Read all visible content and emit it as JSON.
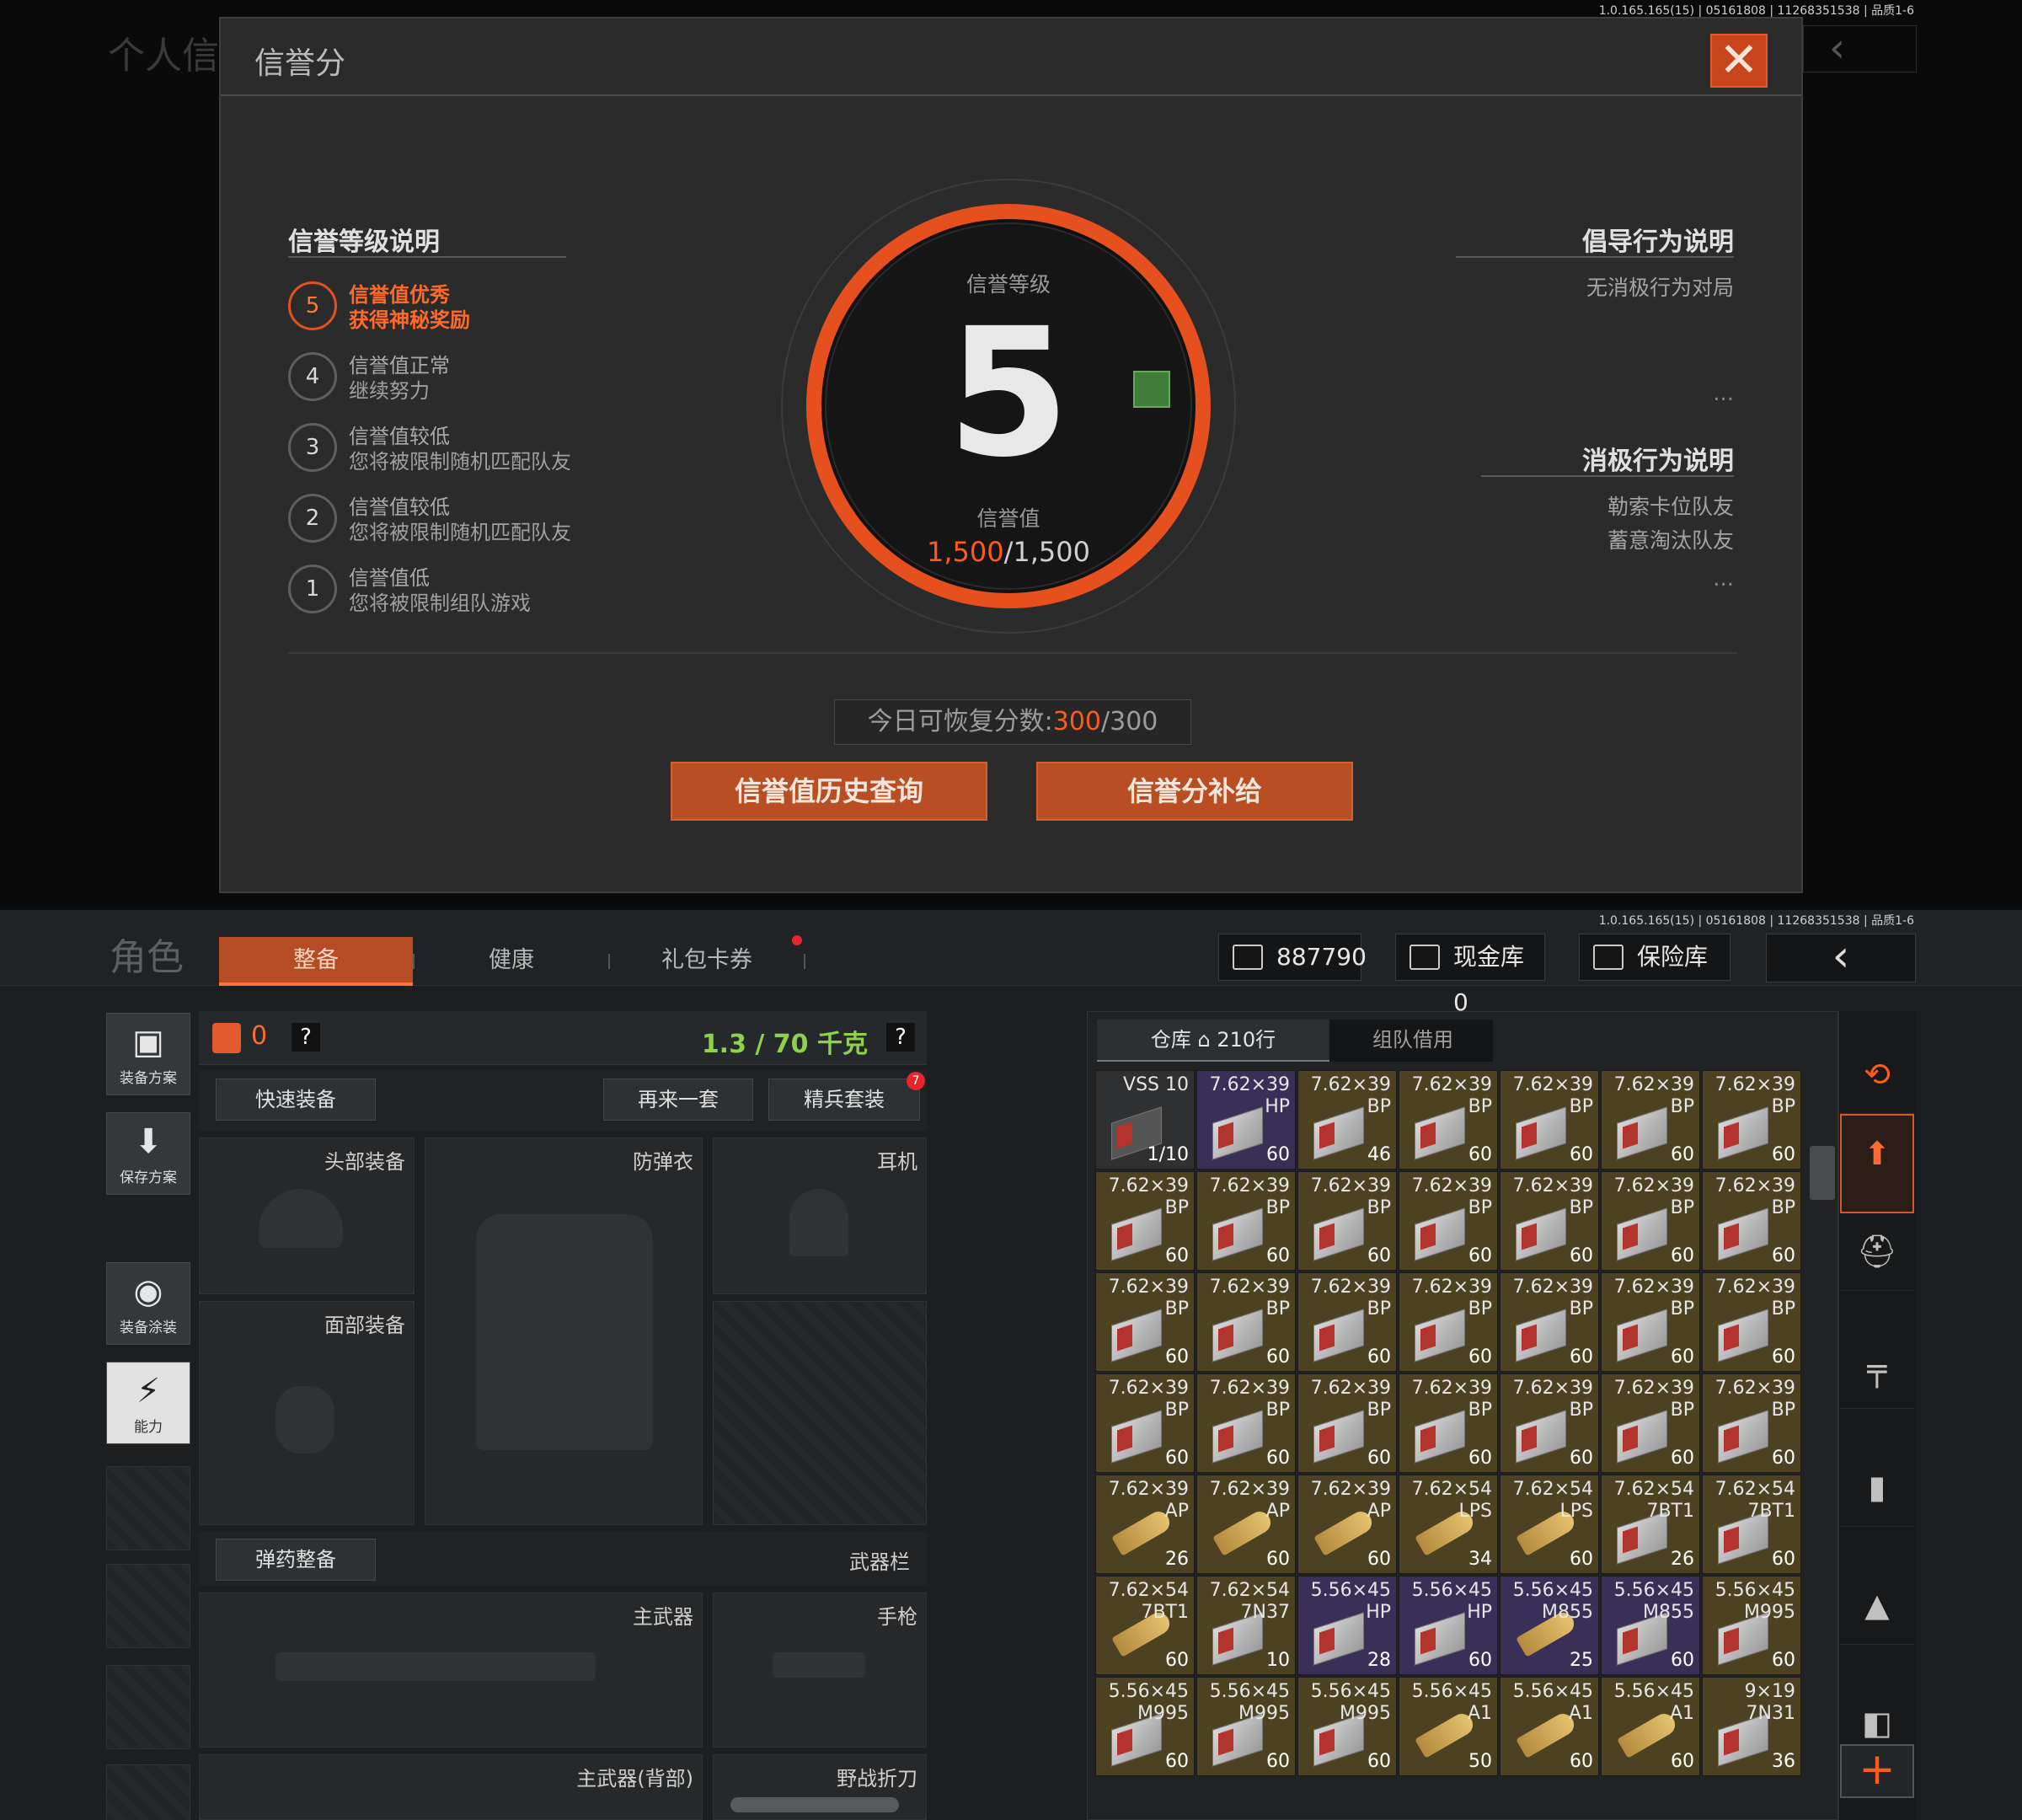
{
  "top": {
    "bg_title": "个人信",
    "bg_back": "‹",
    "version": "1.0.165.165(15) | 05161808 | 11268351538 | 品质1-6",
    "dialog": {
      "title": "信誉分",
      "close": "✕",
      "level_section_title": "信誉等级说明",
      "levels": [
        {
          "num": "5",
          "line1": "信誉值优秀",
          "line2": "获得神秘奖励"
        },
        {
          "num": "4",
          "line1": "信誉值正常",
          "line2": "继续努力"
        },
        {
          "num": "3",
          "line1": "信誉值较低",
          "line2": "您将被限制随机匹配队友"
        },
        {
          "num": "2",
          "line1": "信誉值较低",
          "line2": "您将被限制随机匹配队友"
        },
        {
          "num": "1",
          "line1": "信誉值低",
          "line2": "您将被限制组队游戏"
        }
      ],
      "ring_top_label": "信誉等级",
      "level_value": "5",
      "ring_bottom_label": "信誉值",
      "score_current": "1,500",
      "score_max": "/1,500",
      "guide_title": "倡导行为说明",
      "guide_items": [
        "无消极行为对局"
      ],
      "guide_more": "...",
      "negative_title": "消极行为说明",
      "negative_items": [
        "勒索卡位队友",
        "蓄意淘汰队友"
      ],
      "negative_more": "...",
      "recover_label": "今日可恢复分数:",
      "recover_current": "300",
      "recover_max": "/300",
      "btn_history": "信誉值历史查询",
      "btn_refill": "信誉分补给"
    }
  },
  "bot": {
    "version": "1.0.165.165(15) | 05161808 | 11268351538 | 品质1-6",
    "role_title": "角色",
    "tabs": [
      "整备",
      "健康",
      "礼包卡券"
    ],
    "currency": "887790",
    "cash_vault": "现金库 0",
    "insurance": "保险库",
    "back": "‹",
    "side_buttons": [
      {
        "icon": "▣",
        "label": "装备方案"
      },
      {
        "icon": "⬇",
        "label": "保存方案"
      },
      {
        "icon": "◉",
        "label": "装备涂装"
      },
      {
        "icon": "⚡",
        "label": "能力"
      }
    ],
    "armor_count": "0",
    "help": "?",
    "weight": "1.3 / 70 千克",
    "quick_equip": "快速装备",
    "again_btn": "再来一套",
    "elite_btn": "精兵套装",
    "elite_badge": "7",
    "slots": {
      "head": "头部装备",
      "vest": "防弹衣",
      "ear": "耳机",
      "face": "面部装备",
      "ammo_btn": "弹药整备",
      "weapon_bar": "武器栏",
      "primary": "主武器",
      "pistol": "手枪",
      "primary_back": "主武器(背部)",
      "knife": "野战折刀"
    },
    "inv_tabs": [
      "仓库",
      "210行",
      "组队借用"
    ],
    "inventory": [
      [
        {
          "c": "VSS 10",
          "t": "",
          "n": "1/10",
          "k": "dark",
          "mag": true
        },
        {
          "c": "7.62×39",
          "t": "HP",
          "n": "60",
          "k": "purple"
        },
        {
          "c": "7.62×39",
          "t": "BP",
          "n": "46",
          "k": "gold"
        },
        {
          "c": "7.62×39",
          "t": "BP",
          "n": "60",
          "k": "gold"
        },
        {
          "c": "7.62×39",
          "t": "BP",
          "n": "60",
          "k": "gold"
        },
        {
          "c": "7.62×39",
          "t": "BP",
          "n": "60",
          "k": "gold"
        },
        {
          "c": "7.62×39",
          "t": "BP",
          "n": "60",
          "k": "gold"
        }
      ],
      [
        {
          "c": "7.62×39",
          "t": "BP",
          "n": "60",
          "k": "gold"
        },
        {
          "c": "7.62×39",
          "t": "BP",
          "n": "60",
          "k": "gold"
        },
        {
          "c": "7.62×39",
          "t": "BP",
          "n": "60",
          "k": "gold"
        },
        {
          "c": "7.62×39",
          "t": "BP",
          "n": "60",
          "k": "gold"
        },
        {
          "c": "7.62×39",
          "t": "BP",
          "n": "60",
          "k": "gold"
        },
        {
          "c": "7.62×39",
          "t": "BP",
          "n": "60",
          "k": "gold"
        },
        {
          "c": "7.62×39",
          "t": "BP",
          "n": "60",
          "k": "gold"
        }
      ],
      [
        {
          "c": "7.62×39",
          "t": "BP",
          "n": "60",
          "k": "gold"
        },
        {
          "c": "7.62×39",
          "t": "BP",
          "n": "60",
          "k": "gold"
        },
        {
          "c": "7.62×39",
          "t": "BP",
          "n": "60",
          "k": "gold"
        },
        {
          "c": "7.62×39",
          "t": "BP",
          "n": "60",
          "k": "gold"
        },
        {
          "c": "7.62×39",
          "t": "BP",
          "n": "60",
          "k": "gold"
        },
        {
          "c": "7.62×39",
          "t": "BP",
          "n": "60",
          "k": "gold"
        },
        {
          "c": "7.62×39",
          "t": "BP",
          "n": "60",
          "k": "gold"
        }
      ],
      [
        {
          "c": "7.62×39",
          "t": "BP",
          "n": "60",
          "k": "gold"
        },
        {
          "c": "7.62×39",
          "t": "BP",
          "n": "60",
          "k": "gold"
        },
        {
          "c": "7.62×39",
          "t": "BP",
          "n": "60",
          "k": "gold"
        },
        {
          "c": "7.62×39",
          "t": "BP",
          "n": "60",
          "k": "gold"
        },
        {
          "c": "7.62×39",
          "t": "BP",
          "n": "60",
          "k": "gold"
        },
        {
          "c": "7.62×39",
          "t": "BP",
          "n": "60",
          "k": "gold"
        },
        {
          "c": "7.62×39",
          "t": "BP",
          "n": "60",
          "k": "gold"
        }
      ],
      [
        {
          "c": "7.62×39",
          "t": "AP",
          "n": "26",
          "k": "gold",
          "b": 1
        },
        {
          "c": "7.62×39",
          "t": "AP",
          "n": "60",
          "k": "gold",
          "b": 1
        },
        {
          "c": "7.62×39",
          "t": "AP",
          "n": "60",
          "k": "gold",
          "b": 1
        },
        {
          "c": "7.62×54",
          "t": "LPS",
          "n": "34",
          "k": "gold",
          "b": 1
        },
        {
          "c": "7.62×54",
          "t": "LPS",
          "n": "60",
          "k": "gold",
          "b": 1
        },
        {
          "c": "7.62×54",
          "t": "7BT1",
          "n": "26",
          "k": "gold"
        },
        {
          "c": "7.62×54",
          "t": "7BT1",
          "n": "60",
          "k": "gold"
        }
      ],
      [
        {
          "c": "7.62×54",
          "t": "7BT1",
          "n": "60",
          "k": "gold",
          "b": 1
        },
        {
          "c": "7.62×54",
          "t": "7N37",
          "n": "10",
          "k": "gold"
        },
        {
          "c": "5.56×45",
          "t": "HP",
          "n": "28",
          "k": "purple"
        },
        {
          "c": "5.56×45",
          "t": "HP",
          "n": "60",
          "k": "purple"
        },
        {
          "c": "5.56×45",
          "t": "M855",
          "n": "25",
          "k": "purple",
          "b": 1
        },
        {
          "c": "5.56×45",
          "t": "M855",
          "n": "60",
          "k": "purple"
        },
        {
          "c": "5.56×45",
          "t": "M995",
          "n": "60",
          "k": "gold"
        }
      ],
      [
        {
          "c": "5.56×45",
          "t": "M995",
          "n": "60",
          "k": "gold"
        },
        {
          "c": "5.56×45",
          "t": "M995",
          "n": "60",
          "k": "gold"
        },
        {
          "c": "5.56×45",
          "t": "M995",
          "n": "60",
          "k": "gold"
        },
        {
          "c": "5.56×45",
          "t": "A1",
          "n": "50",
          "k": "gold",
          "b": 1
        },
        {
          "c": "5.56×45",
          "t": "A1",
          "n": "60",
          "k": "gold",
          "b": 1
        },
        {
          "c": "5.56×45",
          "t": "A1",
          "n": "60",
          "k": "gold",
          "b": 1
        },
        {
          "c": "9×19",
          "t": "7N31",
          "n": "36",
          "k": "gold"
        }
      ]
    ],
    "rail_icons": [
      "⟲",
      "⬆",
      "⛑",
      "╤",
      "▮",
      "▲",
      "◧"
    ],
    "plus": "+"
  }
}
